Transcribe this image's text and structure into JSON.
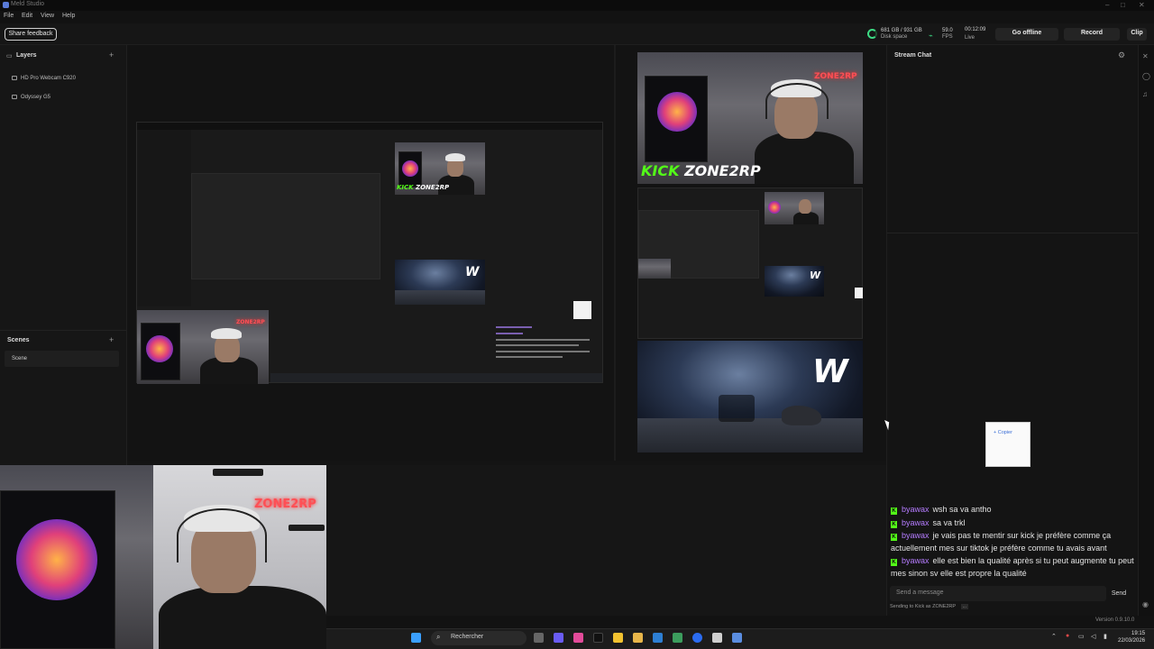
{
  "window": {
    "title": "Meld Studio"
  },
  "menu": [
    "File",
    "Edit",
    "View",
    "Help"
  ],
  "toolbar": {
    "share_feedback": "Share feedback",
    "disk_value": "681 GB / 931 GB",
    "disk_label": "Disk space",
    "fps_value": "59.0",
    "fps_label": "FPS",
    "time_value": "00:12:09",
    "time_label": "Live",
    "go_offline": "Go offline",
    "record": "Record",
    "clip": "Clip"
  },
  "layers": {
    "title": "Layers",
    "items": [
      {
        "label": "HD Pro Webcam C920",
        "icon": "webcam-icon"
      },
      {
        "label": "Odyssey G5",
        "icon": "monitor-icon"
      }
    ]
  },
  "scenes": {
    "title": "Scenes",
    "items": [
      "Scene"
    ]
  },
  "preview": {
    "banner_kick": "KICK",
    "banner_zone": "ZONE2RP",
    "neon_sign": "ZONE2RP",
    "logo_letter": "W"
  },
  "chat": {
    "title": "Stream Chat",
    "copy_label": "+ Copier",
    "messages": [
      {
        "user": "byawax",
        "text": "wsh sa va antho"
      },
      {
        "user": "byawax",
        "text": "sa va trkl"
      },
      {
        "user": "byawax",
        "text": "je vais pas te mentir sur kick je préfère comme ça actuellement mes sur tiktok je préfère comme tu avais avant"
      },
      {
        "user": "byawax",
        "text": "elle est bien la qualité après si tu peut augmente tu peut mes sinon sv elle est propre la qualité"
      }
    ],
    "input_placeholder": "Send a message",
    "send_label": "Send",
    "sending_note": "Sending to Kick as ZONE2RP",
    "more": "..."
  },
  "status": {
    "version": "Version 0.9.10.0"
  },
  "taskbar": {
    "search": "Rechercher",
    "time": "19:15",
    "date": "22/03/2026"
  },
  "colors": {
    "kick_green": "#53fc18",
    "username_purple": "#b57cff",
    "live_ring": "#3ddc84"
  }
}
